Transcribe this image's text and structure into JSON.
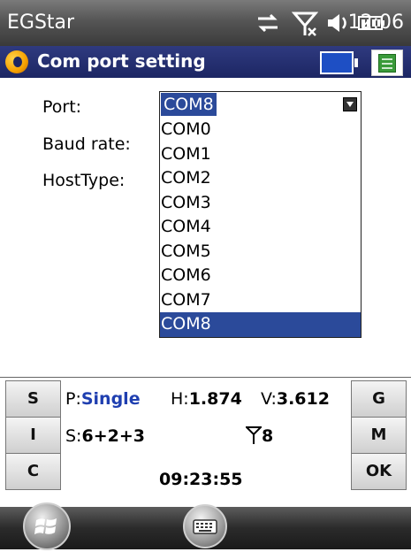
{
  "status": {
    "app_name": "EGStar",
    "time": "12:06"
  },
  "title": {
    "text": "Com port setting"
  },
  "form": {
    "port_label": "Port:",
    "baud_label": "Baud rate:",
    "hosttype_label": "HostType:",
    "port_value": "COM8",
    "port_options": [
      "COM0",
      "COM1",
      "COM2",
      "COM3",
      "COM4",
      "COM5",
      "COM6",
      "COM7",
      "COM8"
    ],
    "selected_index": 8
  },
  "panel": {
    "btn_s": "S",
    "btn_i": "I",
    "btn_c": "C",
    "btn_g": "G",
    "btn_m": "M",
    "btn_ok": "OK",
    "p_prefix": "P:",
    "p_value": "Single",
    "h_prefix": "H:",
    "h_value": "1.874",
    "v_prefix": "V:",
    "v_value": "3.612",
    "s_prefix": "S:",
    "s_value": "6+2+3",
    "antenna_value": "8",
    "clock": "09:23:55"
  },
  "colors": {
    "title_bg": "#1c2663",
    "selection": "#2b4a9a",
    "p_value": "#1f3fb0"
  }
}
